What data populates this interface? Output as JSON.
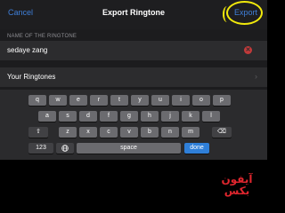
{
  "nav": {
    "cancel": "Cancel",
    "title": "Export Ringtone",
    "export": "Export"
  },
  "name_section": {
    "header": "NAME OF THE RINGTONE",
    "value": "sedaye zang",
    "clear_icon": "clear-circle-icon"
  },
  "your_ringtones": {
    "label": "Your Ringtones",
    "chevron": "›"
  },
  "keyboard": {
    "row1": [
      "q",
      "w",
      "e",
      "r",
      "t",
      "y",
      "u",
      "i",
      "o",
      "p"
    ],
    "row2": [
      "a",
      "s",
      "d",
      "f",
      "g",
      "h",
      "j",
      "k",
      "l"
    ],
    "row3": [
      "z",
      "x",
      "c",
      "v",
      "b",
      "n",
      "m"
    ],
    "shift": "⇧",
    "delete": "⌫",
    "numbers": "123",
    "globe": "globe-icon",
    "space": "space",
    "done": "done"
  },
  "colors": {
    "accent": "#3f7fd9",
    "highlight": "#f2ea0b",
    "watermark": "#e0262e"
  },
  "watermark": {
    "line1": "آیفون",
    "line2": "بکس"
  }
}
